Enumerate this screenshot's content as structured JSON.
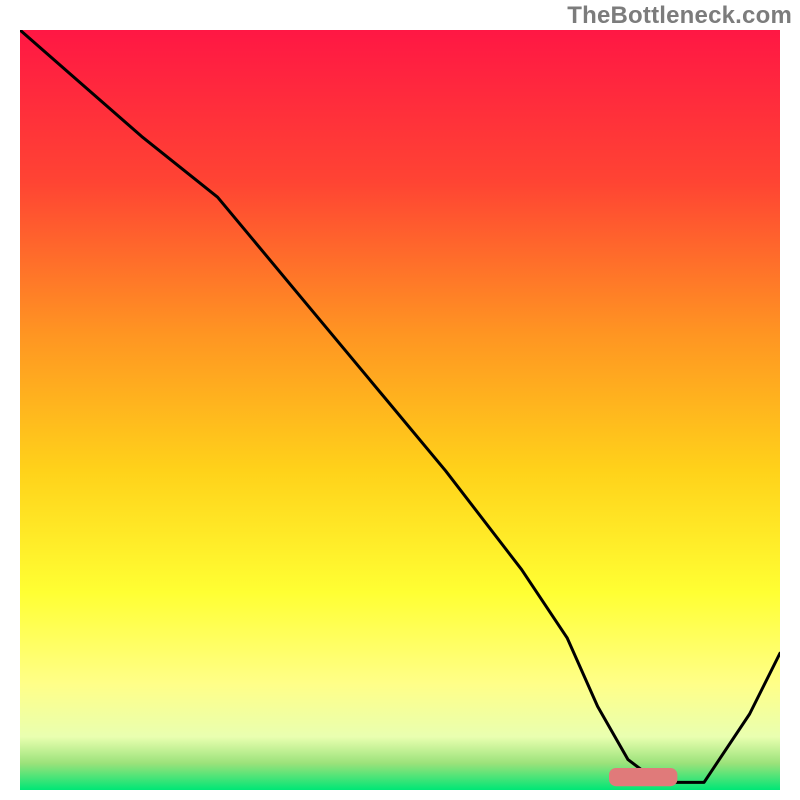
{
  "watermark": "TheBottleneck.com",
  "chart_data": {
    "type": "line",
    "title": "",
    "xlabel": "",
    "ylabel": "",
    "xlim": [
      0,
      100
    ],
    "ylim": [
      0,
      100
    ],
    "grid": false,
    "background": {
      "type": "vertical-gradient",
      "stops": [
        {
          "offset": 0.0,
          "color": "#ff1744"
        },
        {
          "offset": 0.2,
          "color": "#ff4433"
        },
        {
          "offset": 0.4,
          "color": "#ff9522"
        },
        {
          "offset": 0.58,
          "color": "#ffd21a"
        },
        {
          "offset": 0.74,
          "color": "#ffff33"
        },
        {
          "offset": 0.86,
          "color": "#ffff88"
        },
        {
          "offset": 0.93,
          "color": "#e9ffb0"
        },
        {
          "offset": 0.965,
          "color": "#9BE27A"
        },
        {
          "offset": 1.0,
          "color": "#00e676"
        }
      ]
    },
    "series": [
      {
        "name": "bottleneck-curve",
        "type": "line",
        "color": "#000000",
        "x": [
          0,
          8,
          16,
          26,
          36,
          46,
          56,
          66,
          72,
          76,
          80,
          84,
          90,
          96,
          100
        ],
        "y": [
          100,
          93,
          86,
          78,
          66,
          54,
          42,
          29,
          20,
          11,
          4,
          1,
          1,
          10,
          18
        ]
      }
    ],
    "markers": [
      {
        "name": "optimum-band",
        "shape": "rounded-rect",
        "color": "#e07a7a",
        "x_center": 82,
        "y_center": 1.7,
        "width": 9,
        "height": 2.4
      }
    ]
  }
}
